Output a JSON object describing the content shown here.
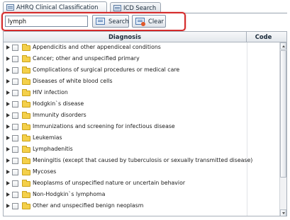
{
  "tabs": [
    {
      "label": "AHRQ Clinical Classification",
      "active": true
    },
    {
      "label": "ICD Search",
      "active": false
    }
  ],
  "search": {
    "value": "lymph",
    "search_label": "Search",
    "clear_label": "Clear"
  },
  "grid": {
    "columns": {
      "diagnosis": "Diagnosis",
      "code": "Code"
    },
    "rows": [
      "Appendicitis and other appendiceal conditions",
      "Cancer; other and unspecified primary",
      "Complications of surgical procedures or medical care",
      "Diseases of white blood cells",
      "HIV infection",
      "Hodgkin`s disease",
      "Immunity disorders",
      "Immunizations and screening for infectious disease",
      "Leukemias",
      "Lymphadenitis",
      "Meningitis (except that caused by tuberculosis or sexually transmitted disease)",
      "Mycoses",
      "Neoplasms of unspecified nature or uncertain behavior",
      "Non-Hodgkin`s lymphoma",
      "Other and unspecified benign neoplasm"
    ]
  },
  "colors": {
    "highlight_border": "#d42a2a",
    "folder": "#f4d04a"
  },
  "icons": {
    "tab": "list-icon",
    "search": "search-icon",
    "clear": "clear-icon",
    "row": "folder-icon"
  }
}
